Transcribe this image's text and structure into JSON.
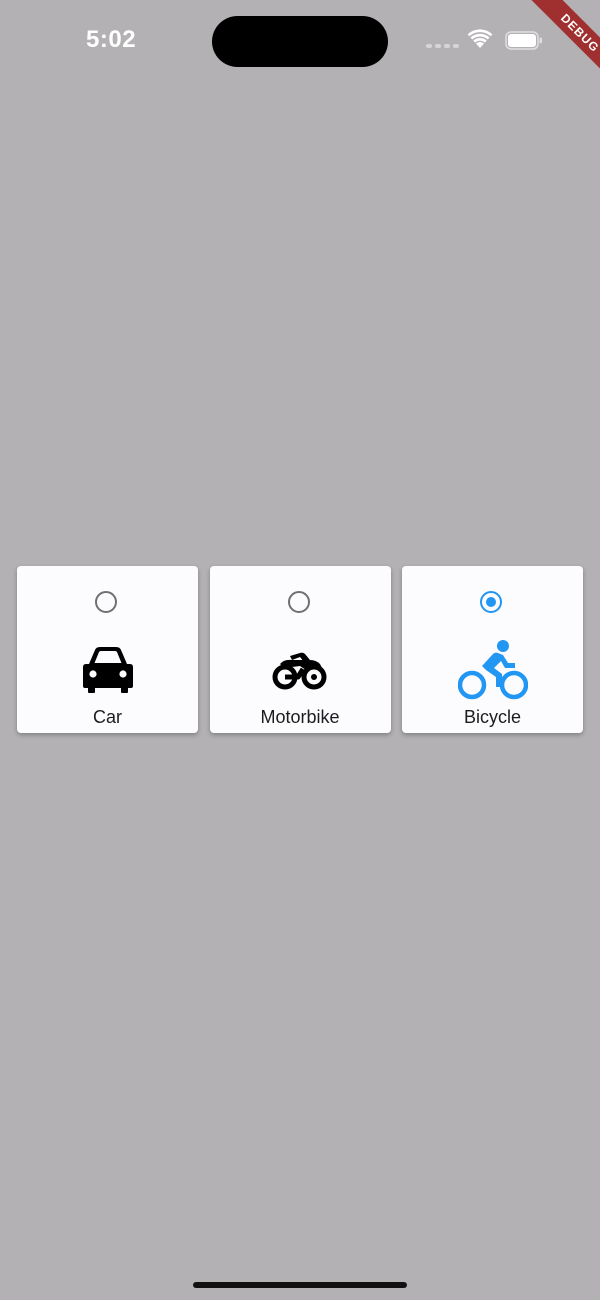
{
  "status_bar": {
    "time": "5:02"
  },
  "debug_banner": {
    "label": "DEBUG",
    "color": "#a0302f"
  },
  "options": [
    {
      "label": "Car",
      "icon": "car-icon",
      "selected": false
    },
    {
      "label": "Motorbike",
      "icon": "motorbike-icon",
      "selected": false
    },
    {
      "label": "Bicycle",
      "icon": "bicycle-icon",
      "selected": true
    }
  ],
  "colors": {
    "background": "#b3b1b3",
    "card": "#fcfbfd",
    "selected_accent": "#2196f3",
    "unselected_radio": "#707070"
  }
}
